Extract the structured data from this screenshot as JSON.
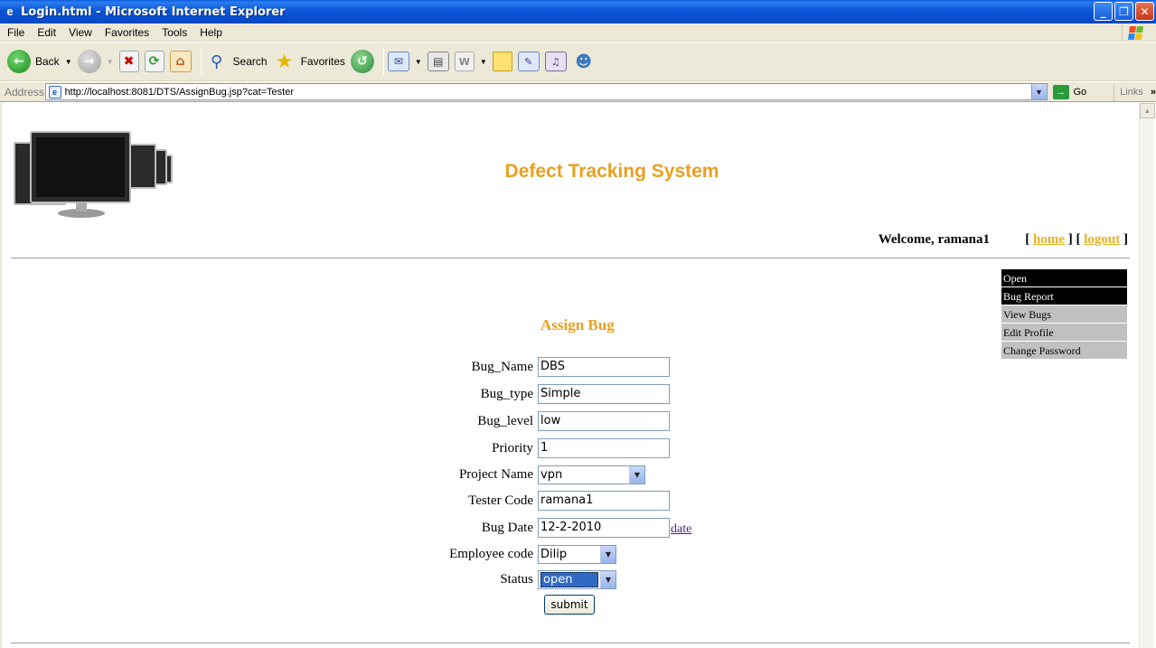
{
  "window": {
    "title": "Login.html - Microsoft Internet Explorer",
    "minimize": "_",
    "maximize": "❐",
    "close": "✕"
  },
  "menu": [
    "File",
    "Edit",
    "View",
    "Favorites",
    "Tools",
    "Help"
  ],
  "toolbar": {
    "back": "Back",
    "search": "Search",
    "favorites": "Favorites"
  },
  "address": {
    "label": "Address",
    "url": "http://localhost:8081/DTS/AssignBug.jsp?cat=Tester",
    "go": "Go",
    "links": "Links"
  },
  "page": {
    "site_title": "Defect Tracking System",
    "welcome": "Welcome,  ramana1",
    "home_link": "home",
    "logout_link": "logout",
    "side_menu": [
      {
        "label": "Open",
        "style": "dark"
      },
      {
        "label": "Bug Report",
        "style": "dark"
      },
      {
        "label": "View Bugs",
        "style": "light"
      },
      {
        "label": "Edit Profile",
        "style": "light"
      },
      {
        "label": "Change Password",
        "style": "light"
      }
    ],
    "form": {
      "title": "Assign Bug",
      "bug_name": {
        "label": "Bug_Name",
        "value": "DBS"
      },
      "bug_type": {
        "label": "Bug_type",
        "value": "Simple"
      },
      "bug_level": {
        "label": "Bug_level",
        "value": "low"
      },
      "priority": {
        "label": "Priority",
        "value": "1"
      },
      "project_name": {
        "label": "Project Name",
        "value": "vpn"
      },
      "tester_code": {
        "label": "Tester Code",
        "value": "ramana1"
      },
      "bug_date": {
        "label": "Bug Date",
        "value": "12-2-2010",
        "link": "date"
      },
      "employee_code": {
        "label": "Employee code",
        "value": "Dilip"
      },
      "status": {
        "label": "Status",
        "value": "open"
      },
      "submit": "submit"
    }
  }
}
